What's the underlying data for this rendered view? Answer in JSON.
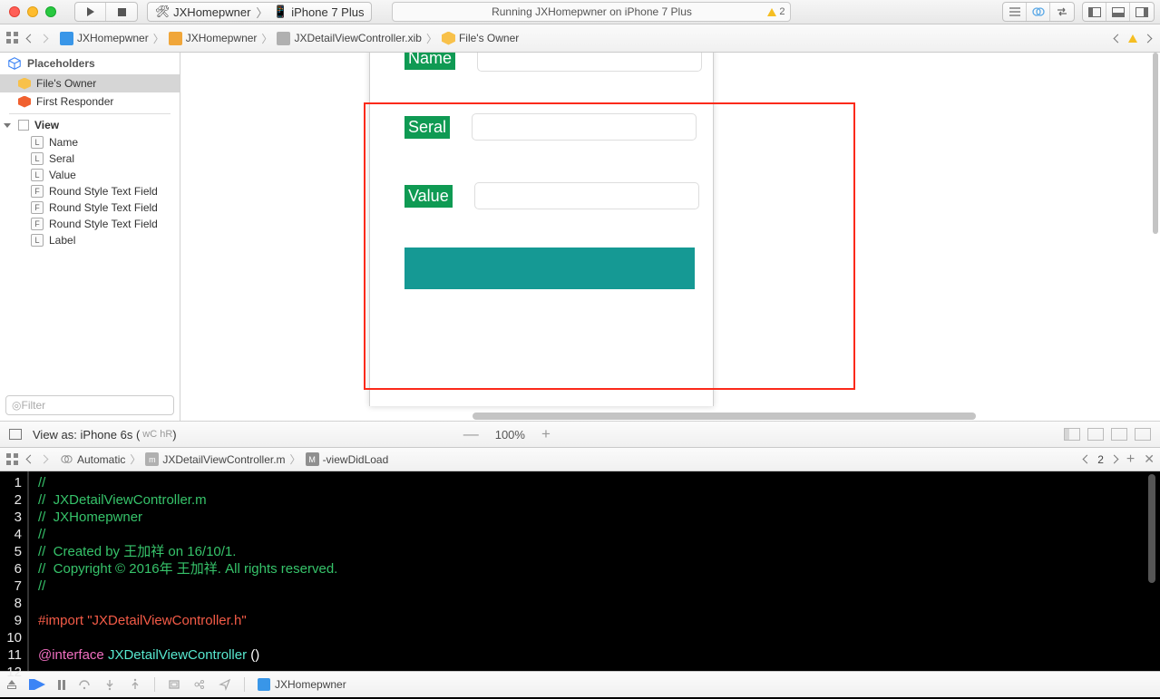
{
  "toolbar": {
    "scheme": "JXHomepwner",
    "destination": "iPhone 7 Plus",
    "status": "Running JXHomepwner on iPhone 7 Plus",
    "warn_count": "2"
  },
  "jumpbar": {
    "project": "JXHomepwner",
    "group": "JXHomepwner",
    "file": "JXDetailViewController.xib",
    "owner": "File's Owner"
  },
  "outline": {
    "placeholders_header": "Placeholders",
    "files_owner": "File's Owner",
    "first_responder": "First Responder",
    "view_header": "View",
    "items": [
      {
        "tag": "L",
        "label": "Name"
      },
      {
        "tag": "L",
        "label": "Seral"
      },
      {
        "tag": "L",
        "label": "Value"
      },
      {
        "tag": "F",
        "label": "Round Style Text Field"
      },
      {
        "tag": "F",
        "label": "Round Style Text Field"
      },
      {
        "tag": "F",
        "label": "Round Style Text Field"
      },
      {
        "tag": "L",
        "label": "Label"
      }
    ],
    "filter_placeholder": "Filter"
  },
  "canvas": {
    "name_label": "Name",
    "seral_label": "Seral",
    "value_label": "Value",
    "view_as": "View as: iPhone 6s (",
    "wcr": "wC hR",
    "zoom": "100%"
  },
  "editor_bar": {
    "automatic": "Automatic",
    "file": "JXDetailViewController.m",
    "method": "-viewDidLoad",
    "issue_count": "2"
  },
  "code": {
    "l1": "//",
    "l2a": "//  ",
    "l2b": "JXDetailViewController.m",
    "l3a": "//  ",
    "l3b": "JXHomepwner",
    "l4": "//",
    "l5": "//  Created by 王加祥 on 16/10/1.",
    "l6": "//  Copyright © 2016年 王加祥. All rights reserved.",
    "l7": "//",
    "l8": "",
    "l9a": "#import ",
    "l9b": "\"JXDetailViewController.h\"",
    "l10": "",
    "l11a": "@interface ",
    "l11b": "JXDetailViewController ",
    "l11c": "()"
  },
  "debug": {
    "project": "JXHomepwner"
  }
}
